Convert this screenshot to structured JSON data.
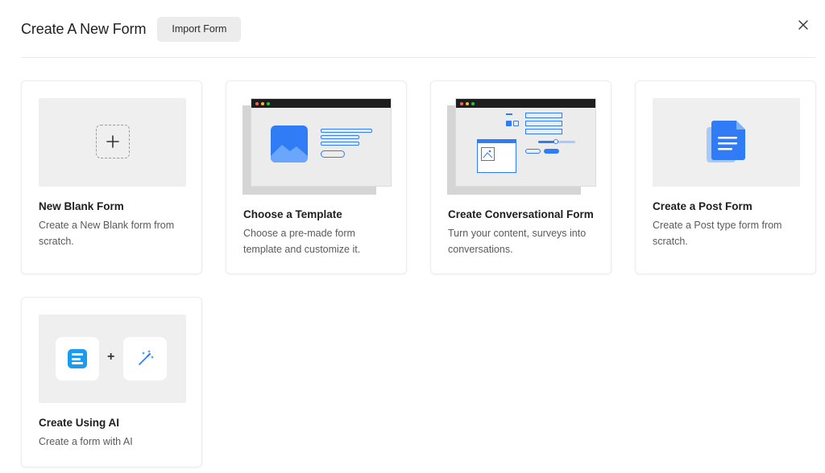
{
  "header": {
    "title": "Create A New Form",
    "import_label": "Import Form"
  },
  "cards": [
    {
      "title": "New Blank Form",
      "desc": "Create a New Blank form from scratch."
    },
    {
      "title": "Choose a Template",
      "desc": "Choose a pre-made form template and customize it."
    },
    {
      "title": "Create Conversational Form",
      "desc": "Turn your content, surveys into conversations."
    },
    {
      "title": "Create a Post Form",
      "desc": "Create a Post type form from scratch."
    },
    {
      "title": "Create Using AI",
      "desc": "Create a form with AI"
    }
  ],
  "icons": {
    "close": "close-icon",
    "plus": "plus-icon",
    "image": "image-icon",
    "document": "document-icon",
    "fluent_logo": "fluent-forms-logo-icon",
    "magic_wand": "magic-wand-icon"
  },
  "colors": {
    "accent_blue": "#2f7cf6",
    "light_blue": "#a9c8fb",
    "browser_dark": "#1e1e1e",
    "dot_red": "#ff5f57",
    "dot_yellow": "#febc2e",
    "dot_green": "#28c840"
  },
  "ai_plus": "+"
}
